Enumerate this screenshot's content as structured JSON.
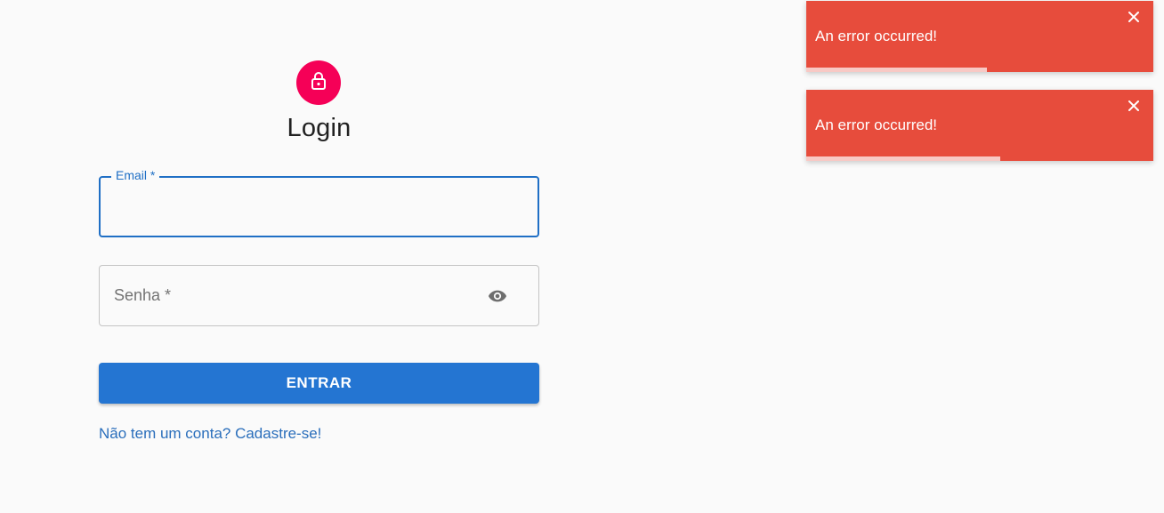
{
  "login": {
    "title": "Login",
    "email_label": "Email *",
    "email_value": "",
    "password_label": "Senha *",
    "password_value": "",
    "submit_label": "ENTRAR",
    "signup_link": "Não tem um conta? Cadastre-se!"
  },
  "icons": {
    "avatar": "lock-icon",
    "password_toggle": "eye-icon",
    "toast_close": "close-icon"
  },
  "colors": {
    "primary": "#2475d2",
    "avatar_bg": "#f50057",
    "toast_error": "#e74c3c",
    "background": "#fafafa"
  },
  "toasts": [
    {
      "message": "An error occurred!",
      "progress": 0.52
    },
    {
      "message": "An error occurred!",
      "progress": 0.56
    }
  ]
}
